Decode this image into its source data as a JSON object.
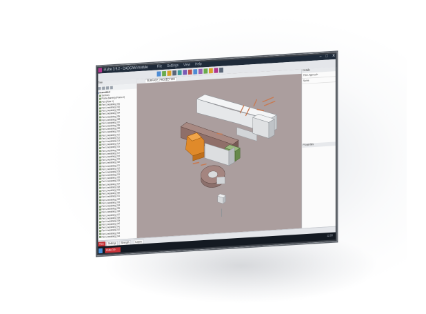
{
  "window": {
    "title": "iKube 3.9.2 - CADCAM module",
    "menu": [
      "File",
      "Settings",
      "View",
      "Help"
    ],
    "controls": [
      "–",
      "□",
      "✕"
    ]
  },
  "left_panel": {
    "header": "Tree",
    "root_label": "Assembled",
    "items": [
      "Sections",
      "Frame-Banning (Frame-1)",
      "Part (Plate-1)",
      "Part Lineplating_001",
      "Part Lineplating_002",
      "Part Lineplating_003",
      "Part Lineplating_004",
      "Part Lineplating_005",
      "Part Lineplating_006",
      "Part Lineplating_007",
      "Part Lineplating_008",
      "Part Lineplating_009",
      "Part Lineplating_010",
      "Part Lineplating_011",
      "Part Lineplating_012",
      "Part Lineplating_013",
      "Part Lineplating_014",
      "Part Lineplating_015",
      "Part Lineplating_016",
      "Part Lineplating_017",
      "Part Lineplating_018",
      "Part Lineplating_019",
      "Part Lineplating_020",
      "Part Lineplating_021",
      "Part Lineplating_022",
      "Part Lineplating_023",
      "Part Lineplating_024",
      "Part Lineplating_025",
      "Part Lineplating_026",
      "Part Lineplating_027",
      "Part Lineplating_028",
      "Part Lineplating_029",
      "Part Lineplating_030",
      "Part Lineplating_031",
      "Part Lineplating_032",
      "Part Lineplating_033",
      "Part Lineplating_034",
      "Part Lineplating_035",
      "Part Lineplating_036",
      "Part Lineplating_037",
      "Part Lineplating_038",
      "Part Lineplating_039",
      "Part Lineplating_040",
      "Part Lineplating_041",
      "Part Lineplating_042",
      "Part Lineplating_043",
      "Part Lineplating_044"
    ]
  },
  "viewport": {
    "tab_label": "SURFACE_PROJECTION"
  },
  "right_panel": {
    "header": "Details",
    "props": [
      "Filter   Approach",
      "Name"
    ],
    "header2": "Properties"
  },
  "bottom_tabs": [
    "Tree",
    "Settings",
    "Strength",
    "Layers"
  ],
  "taskbar": {
    "task": "iKube 3.9",
    "tray": "12:00"
  },
  "colors": {
    "viewport_bg": "#ab9e9e",
    "accent": "#c8343a",
    "part_orange": "#e08a2a",
    "part_grey": "#d8dadc",
    "part_green": "#7fa063",
    "part_copper": "#c87a52"
  }
}
